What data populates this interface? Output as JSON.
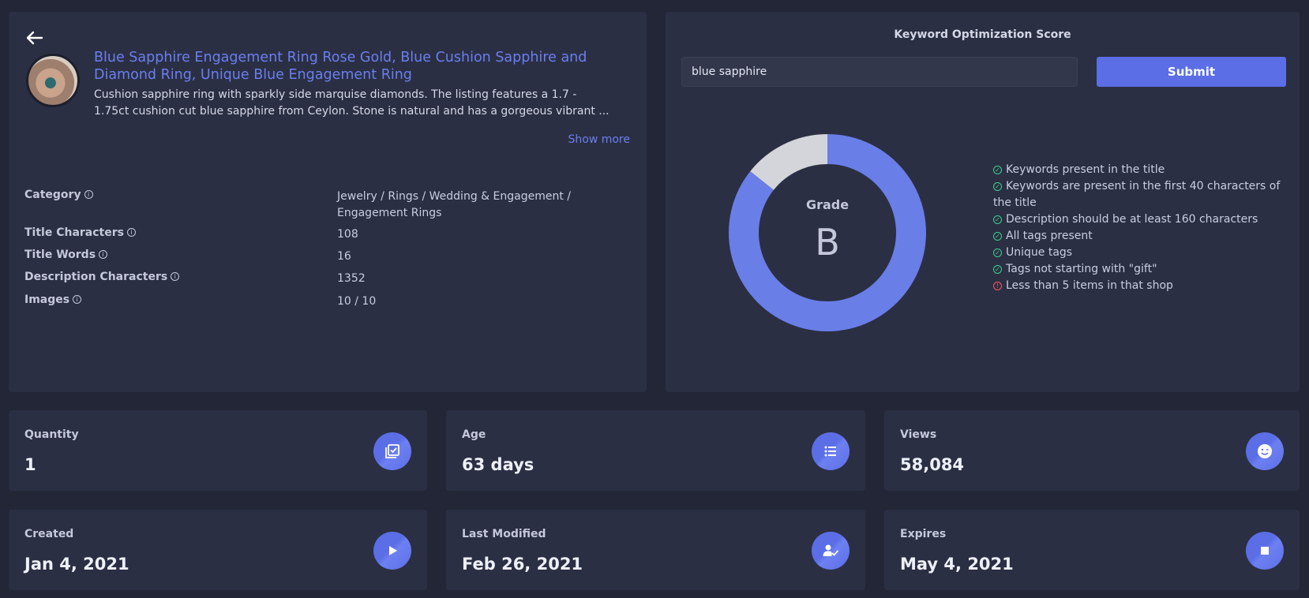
{
  "listing": {
    "title": "Blue Sapphire Engagement Ring Rose Gold, Blue Cushion Sapphire and Diamond Ring, Unique Blue Engagement Ring",
    "description": "Cushion sapphire ring with sparkly side marquise diamonds. The listing features a 1.7 - 1.75ct cushion cut blue sapphire from Ceylon. Stone is natural and has a gorgeous vibrant ...",
    "show_more": "Show more",
    "meta": [
      {
        "label": "Category",
        "value": "Jewelry / Rings / Wedding & Engagement / Engagement Rings"
      },
      {
        "label": "Title Characters",
        "value": "108"
      },
      {
        "label": "Title Words",
        "value": "16"
      },
      {
        "label": "Description Characters",
        "value": "1352"
      },
      {
        "label": "Images",
        "value": "10 / 10"
      }
    ]
  },
  "score": {
    "title": "Keyword Optimization Score",
    "input_value": "blue sapphire",
    "submit_label": "Submit",
    "grade_label": "Grade",
    "grade": "B",
    "checks": [
      {
        "text": "Keywords present in the title",
        "status": "ok"
      },
      {
        "text": "Keywords are present in the first 40 characters of the title",
        "status": "ok"
      },
      {
        "text": "Description should be at least 160 characters",
        "status": "ok"
      },
      {
        "text": "All tags present",
        "status": "ok"
      },
      {
        "text": "Unique tags",
        "status": "ok"
      },
      {
        "text": "Tags not starting with \"gift\"",
        "status": "ok"
      },
      {
        "text": "Less than 5 items in that shop",
        "status": "error"
      }
    ]
  },
  "chart_data": {
    "type": "pie",
    "values": [
      6,
      1
    ],
    "colors": [
      "#6a7ee8",
      "#d3d5da"
    ]
  },
  "stats": {
    "quantity": {
      "label": "Quantity",
      "value": "1",
      "icon": "checklist-icon"
    },
    "age": {
      "label": "Age",
      "value": "63 days",
      "icon": "list-icon"
    },
    "views": {
      "label": "Views",
      "value": "58,084",
      "icon": "smiley-icon"
    },
    "created": {
      "label": "Created",
      "value": "Jan 4, 2021",
      "icon": "play-icon"
    },
    "modified": {
      "label": "Last Modified",
      "value": "Feb 26, 2021",
      "icon": "user-check-icon"
    },
    "expires": {
      "label": "Expires",
      "value": "May 4, 2021",
      "icon": "stop-icon"
    }
  },
  "colors": {
    "background": "#222636",
    "card": "#2b2f43",
    "accent": "#5b6ee6",
    "link": "#6a7ff0",
    "ok": "#3ecf8e",
    "error": "#f25a5a"
  }
}
